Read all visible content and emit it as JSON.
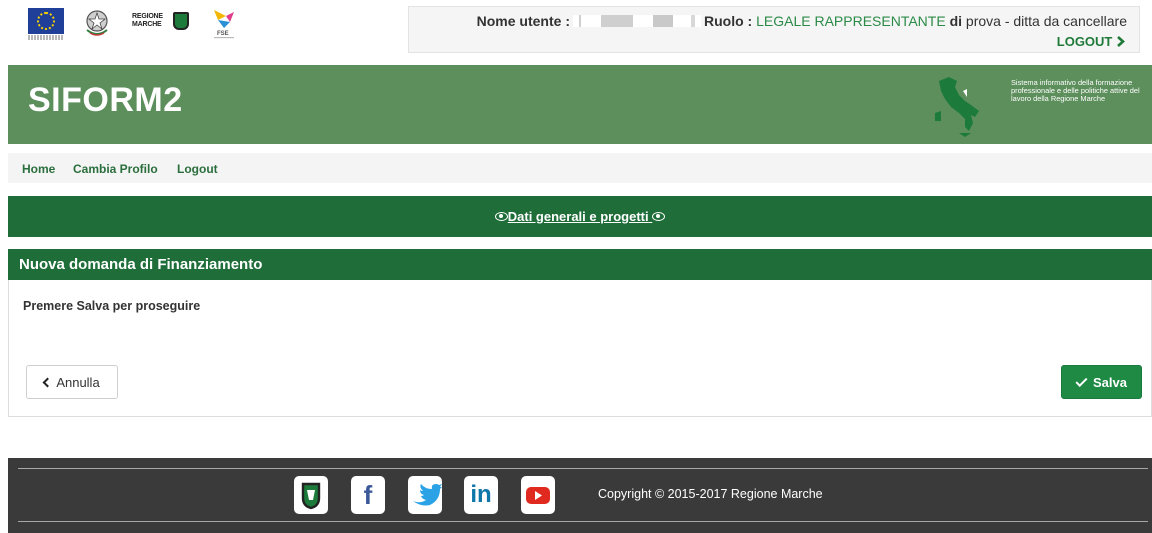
{
  "user_bar": {
    "user_label": "Nome utente :",
    "role_label": "Ruolo :",
    "role_value": "LEGALE RAPPRESENTANTE",
    "company": "di prova - ditta da cancellare",
    "logout_label": "LOGOUT",
    "logos": {
      "eu_logo": "eu-flag-logo",
      "republic_logo": "italian-republic-emblem",
      "region_logo": "regione-marche-logo",
      "region_logo_text": "REGIONE MARCHE",
      "fse_logo": "fse-logo"
    }
  },
  "header": {
    "app_title": "SIFORM2",
    "description": "Sistema informativo della formazione professionale e delle politiche attive del lavoro della Regione Marche"
  },
  "nav": {
    "items": [
      {
        "label": "Home"
      },
      {
        "label": "Cambia Profilo"
      },
      {
        "label": "Logout"
      }
    ]
  },
  "section_link": {
    "label": "Dati generali e progetti"
  },
  "panel": {
    "title": "Nuova domanda di Finanziamento",
    "message": "Premere Salva per proseguire",
    "cancel_label": "Annulla",
    "save_label": "Salva"
  },
  "footer": {
    "copyright": "Copyright © 2015-2017 Regione Marche",
    "social": [
      "regione-marche-icon",
      "facebook-icon",
      "twitter-icon",
      "linkedin-icon",
      "youtube-icon"
    ]
  },
  "colors": {
    "banner": "#5c8f5c",
    "dark_green": "#1f6e3a",
    "save_button": "#1e8a44",
    "footer": "#3a3a3a"
  }
}
